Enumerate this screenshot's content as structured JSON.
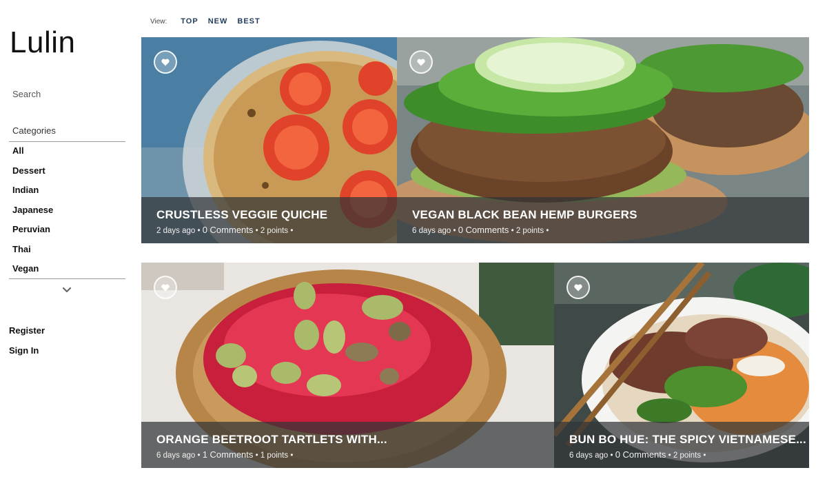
{
  "brand": {
    "logo_text": "Lulin"
  },
  "sidebar": {
    "search_label": "Search",
    "categories_label": "Categories",
    "categories": [
      "All",
      "Dessert",
      "Indian",
      "Japanese",
      "Peruvian",
      "Thai",
      "Vegan"
    ],
    "expand_icon": "chevron-down-icon",
    "auth_links": [
      "Register",
      "Sign In"
    ]
  },
  "viewbar": {
    "label": "View:",
    "options": [
      "TOP",
      "NEW",
      "BEST"
    ]
  },
  "cards": [
    {
      "title": "CRUSTLESS VEGGIE QUICHE",
      "age": "2 days ago",
      "comments": "0 Comments",
      "points": "2 points",
      "heart_icon": "heart-icon"
    },
    {
      "title": "VEGAN BLACK BEAN HEMP BURGERS",
      "age": "6 days ago",
      "comments": "0 Comments",
      "points": "2 points",
      "heart_icon": "heart-icon"
    },
    {
      "title": "ORANGE BEETROOT TARTLETS WITH...",
      "age": "6 days ago",
      "comments": "1 Comments",
      "points": "1 points",
      "heart_icon": "heart-icon"
    },
    {
      "title": "BUN BO HUE: THE SPICY VIETNAMESE...",
      "age": "6 days ago",
      "comments": "0 Comments",
      "points": "2 points",
      "heart_icon": "heart-icon"
    }
  ],
  "meta_separator": "•",
  "colors": {
    "overlay": "#323437",
    "nav_link": "#1f3a5a",
    "rule": "#999999"
  }
}
